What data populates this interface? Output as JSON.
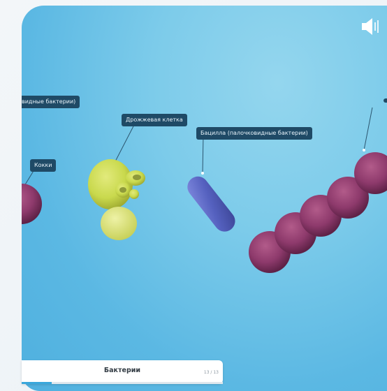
{
  "labels": {
    "rod_partial": "видные бактерии)",
    "yeast": "Дрожжевая клетка",
    "bacillus": "Бацилла (палочковидные бактерии)",
    "cocci": "Кокки"
  },
  "icons": {
    "sound": "speaker-icon"
  },
  "bottom_bar": {
    "title": "Бактерии",
    "page_indicator": "13 / 13",
    "progress": 0.15
  },
  "colors": {
    "stage_blue": "#5bb8e3",
    "tag_bg": "#1f4a66",
    "yeast": "#c9d94d",
    "bacillus": "#5561bf",
    "cocci": "#8e3a6c",
    "progress": "#3aa8dc"
  }
}
